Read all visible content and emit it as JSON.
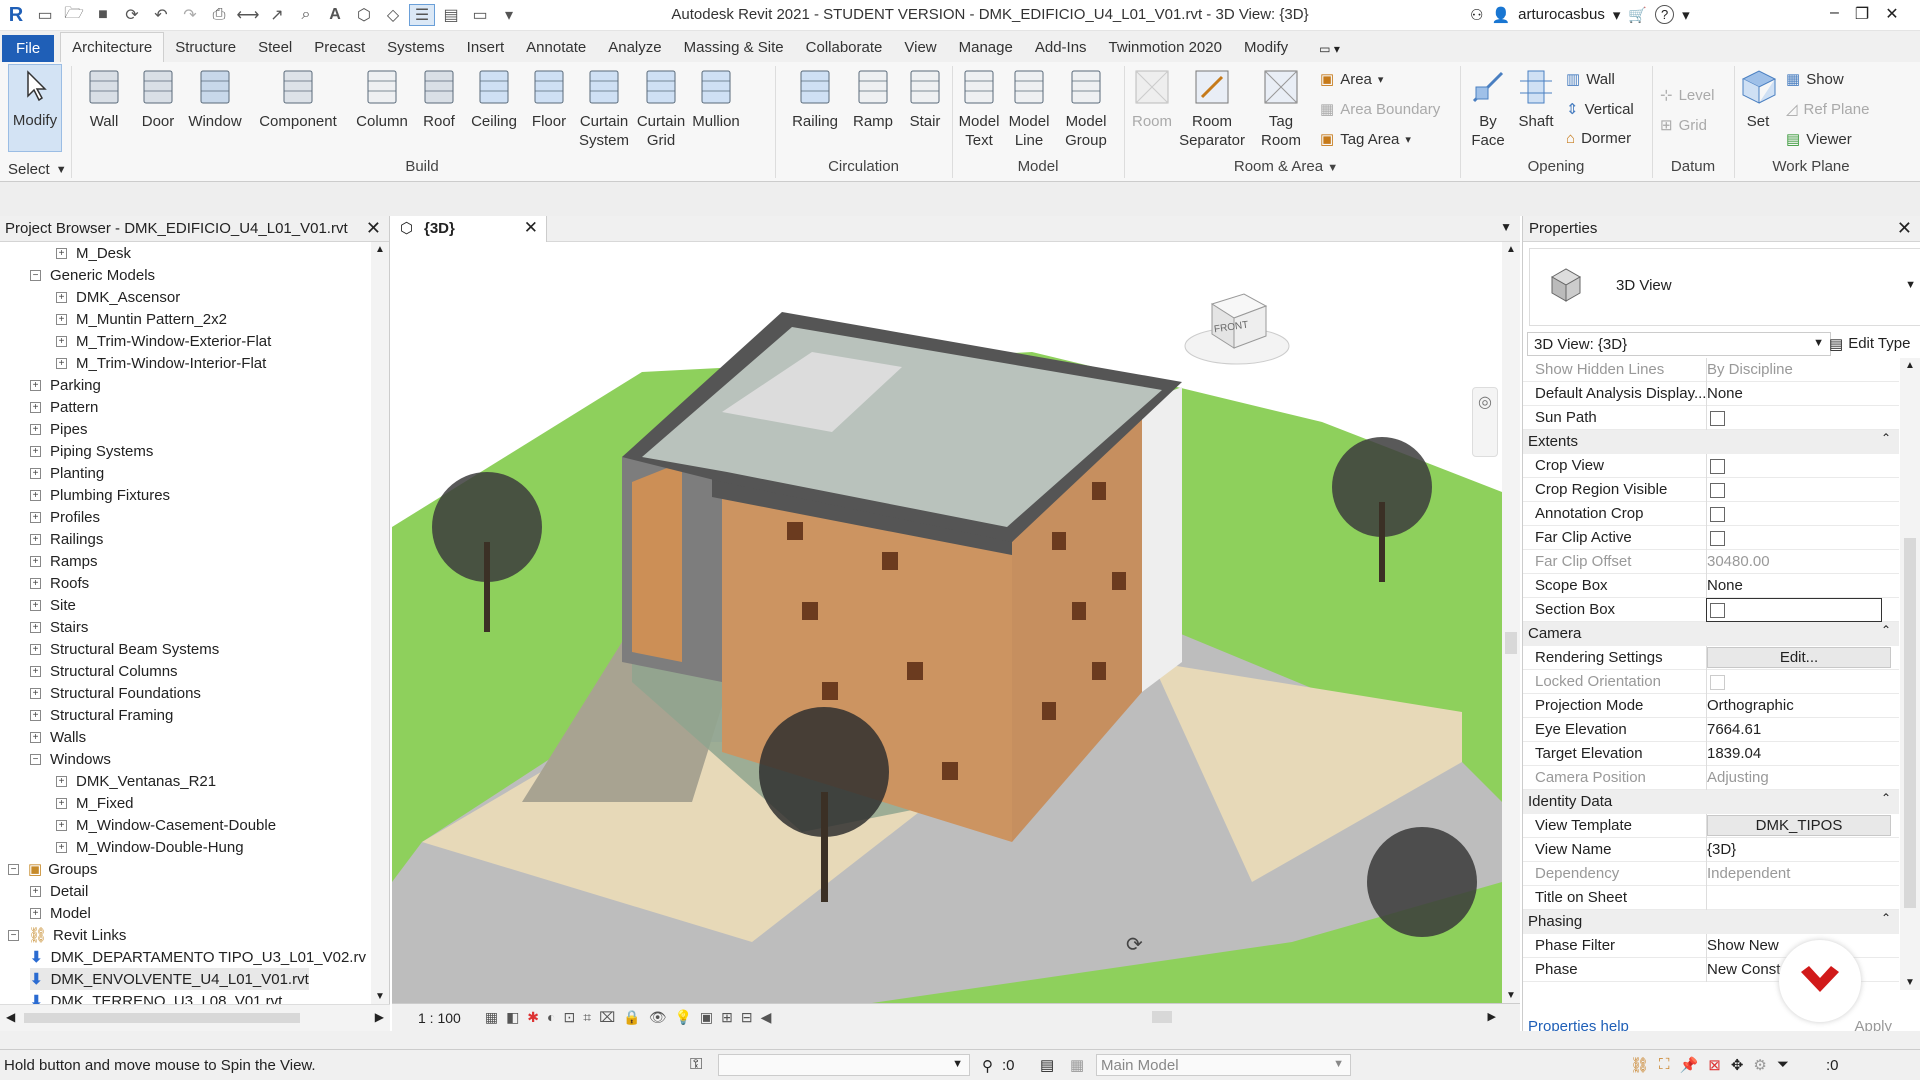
{
  "app": {
    "title": "Autodesk Revit 2021 - STUDENT VERSION - DMK_EDIFICIO_U4_L01_V01.rvt - 3D View: {3D}",
    "user": "arturocasbus",
    "accent_color": "#1f5fb7"
  },
  "tabs": [
    "File",
    "Architecture",
    "Structure",
    "Steel",
    "Precast",
    "Systems",
    "Insert",
    "Annotate",
    "Analyze",
    "Massing & Site",
    "Collaborate",
    "View",
    "Manage",
    "Add-Ins",
    "Twinmotion 2020",
    "Modify"
  ],
  "ribbon": {
    "modify": "Modify",
    "select": "Select",
    "build": {
      "label": "Build",
      "items": [
        "Wall",
        "Door",
        "Window",
        "Component",
        "Column",
        "Roof",
        "Ceiling",
        "Floor",
        "Curtain System",
        "Curtain Grid",
        "Mullion"
      ]
    },
    "circulation": {
      "label": "Circulation",
      "items": [
        "Railing",
        "Ramp",
        "Stair"
      ]
    },
    "model": {
      "label": "Model",
      "items": [
        "Model Text",
        "Model Line",
        "Model Group"
      ]
    },
    "room_area": {
      "label": "Room & Area",
      "room": "Room",
      "room_separator": "Room Separator",
      "tag_room": "Tag Room",
      "area": "Area",
      "area_boundary": "Area  Boundary",
      "tag_area": "Tag  Area"
    },
    "opening": {
      "label": "Opening",
      "by_face": "By Face",
      "shaft": "Shaft",
      "wall": "Wall",
      "vertical": "Vertical",
      "dormer": "Dormer"
    },
    "datum": {
      "label": "Datum",
      "level": "Level",
      "grid": "Grid"
    },
    "work_plane": {
      "label": "Work Plane",
      "set": "Set",
      "show": "Show",
      "ref_plane": "Ref  Plane",
      "viewer": "Viewer"
    }
  },
  "project_browser": {
    "title": "Project Browser - DMK_EDIFICIO_U4_L01_V01.rvt",
    "items": [
      {
        "label": "M_Desk",
        "level": 2,
        "box": "+"
      },
      {
        "label": "Generic Models",
        "level": 1,
        "box": "-"
      },
      {
        "label": "DMK_Ascensor",
        "level": 2,
        "box": "+"
      },
      {
        "label": "M_Muntin Pattern_2x2",
        "level": 2,
        "box": "+"
      },
      {
        "label": "M_Trim-Window-Exterior-Flat",
        "level": 2,
        "box": "+"
      },
      {
        "label": "M_Trim-Window-Interior-Flat",
        "level": 2,
        "box": "+"
      },
      {
        "label": "Parking",
        "level": 1,
        "box": "+"
      },
      {
        "label": "Pattern",
        "level": 1,
        "box": "+"
      },
      {
        "label": "Pipes",
        "level": 1,
        "box": "+"
      },
      {
        "label": "Piping Systems",
        "level": 1,
        "box": "+"
      },
      {
        "label": "Planting",
        "level": 1,
        "box": "+"
      },
      {
        "label": "Plumbing Fixtures",
        "level": 1,
        "box": "+"
      },
      {
        "label": "Profiles",
        "level": 1,
        "box": "+"
      },
      {
        "label": "Railings",
        "level": 1,
        "box": "+"
      },
      {
        "label": "Ramps",
        "level": 1,
        "box": "+"
      },
      {
        "label": "Roofs",
        "level": 1,
        "box": "+"
      },
      {
        "label": "Site",
        "level": 1,
        "box": "+"
      },
      {
        "label": "Stairs",
        "level": 1,
        "box": "+"
      },
      {
        "label": "Structural Beam Systems",
        "level": 1,
        "box": "+"
      },
      {
        "label": "Structural Columns",
        "level": 1,
        "box": "+"
      },
      {
        "label": "Structural Foundations",
        "level": 1,
        "box": "+"
      },
      {
        "label": "Structural Framing",
        "level": 1,
        "box": "+"
      },
      {
        "label": "Walls",
        "level": 1,
        "box": "+"
      },
      {
        "label": "Windows",
        "level": 1,
        "box": "-"
      },
      {
        "label": "DMK_Ventanas_R21",
        "level": 2,
        "box": "+"
      },
      {
        "label": "M_Fixed",
        "level": 2,
        "box": "+"
      },
      {
        "label": "M_Window-Casement-Double",
        "level": 2,
        "box": "+"
      },
      {
        "label": "M_Window-Double-Hung",
        "level": 2,
        "box": "+"
      },
      {
        "label": "Groups",
        "level": 0,
        "box": "-"
      },
      {
        "label": "Detail",
        "level": 1,
        "box": "+"
      },
      {
        "label": "Model",
        "level": 1,
        "box": "+"
      },
      {
        "label": "Revit Links",
        "level": 0,
        "box": "-"
      },
      {
        "label": "DMK_DEPARTAMENTO TIPO_U3_L01_V02.rv",
        "level": 1,
        "box": "link"
      },
      {
        "label": "DMK_ENVOLVENTE_U4_L01_V01.rvt",
        "level": 1,
        "box": "link",
        "selected": true
      },
      {
        "label": "DMK_TERRENO_U3_L08_V01.rvt",
        "level": 1,
        "box": "link"
      }
    ]
  },
  "view": {
    "tab_label": "{3D}",
    "scale": "1 : 100",
    "viewcube_face": "FRONT"
  },
  "properties": {
    "title": "Properties",
    "type_name": "3D View",
    "selector": "3D View: {3D}",
    "edit_type": "Edit Type",
    "help": "Properties help",
    "apply": "Apply",
    "rows": [
      {
        "kind": "prop",
        "k": "Show Hidden Lines",
        "v": "By Discipline",
        "dim": true
      },
      {
        "kind": "prop",
        "k": "Default Analysis Display...",
        "v": "None"
      },
      {
        "kind": "check",
        "k": "Sun Path"
      },
      {
        "kind": "group",
        "k": "Extents"
      },
      {
        "kind": "check",
        "k": "Crop View"
      },
      {
        "kind": "check",
        "k": "Crop Region Visible"
      },
      {
        "kind": "check",
        "k": "Annotation Crop"
      },
      {
        "kind": "check",
        "k": "Far Clip Active"
      },
      {
        "kind": "prop",
        "k": "Far Clip Offset",
        "v": "30480.00",
        "dim": true
      },
      {
        "kind": "prop",
        "k": "Scope Box",
        "v": "None"
      },
      {
        "kind": "check",
        "k": "Section Box",
        "active": true
      },
      {
        "kind": "group",
        "k": "Camera"
      },
      {
        "kind": "button",
        "k": "Rendering Settings",
        "v": "Edit..."
      },
      {
        "kind": "check",
        "k": "Locked Orientation",
        "dim": true
      },
      {
        "kind": "prop",
        "k": "Projection Mode",
        "v": "Orthographic"
      },
      {
        "kind": "prop",
        "k": "Eye Elevation",
        "v": "7664.61"
      },
      {
        "kind": "prop",
        "k": "Target Elevation",
        "v": "1839.04"
      },
      {
        "kind": "prop",
        "k": "Camera Position",
        "v": "Adjusting",
        "dim": true
      },
      {
        "kind": "group",
        "k": "Identity Data"
      },
      {
        "kind": "button",
        "k": "View Template",
        "v": "DMK_TIPOS"
      },
      {
        "kind": "prop",
        "k": "View Name",
        "v": "{3D}"
      },
      {
        "kind": "prop",
        "k": "Dependency",
        "v": "Independent",
        "dim": true
      },
      {
        "kind": "prop",
        "k": "Title on Sheet",
        "v": ""
      },
      {
        "kind": "group",
        "k": "Phasing"
      },
      {
        "kind": "prop",
        "k": "Phase Filter",
        "v": "Show New"
      },
      {
        "kind": "prop",
        "k": "Phase",
        "v": "New Const"
      }
    ]
  },
  "status": {
    "message": "Hold button and move mouse to Spin the View.",
    "count_left": ":0",
    "model": "Main Model",
    "count_right": ":0"
  }
}
